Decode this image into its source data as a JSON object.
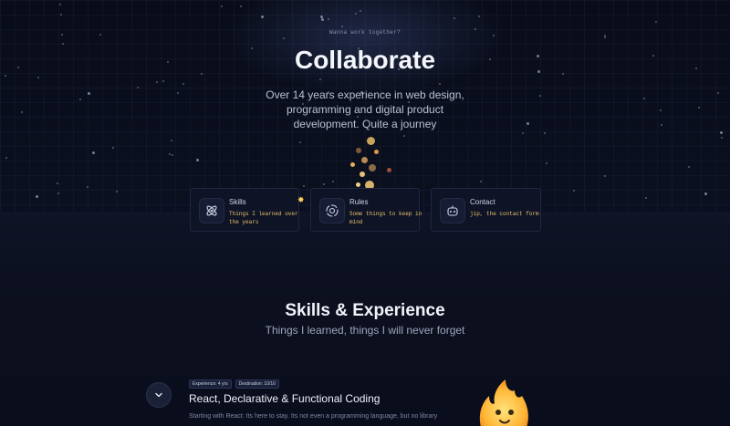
{
  "hero": {
    "eyebrow": "Wanna work together?",
    "title": "Collaborate",
    "subtitle": "Over 14 years experience in web design, programming and digital product development. Quite a journey"
  },
  "cards": [
    {
      "name": "Skills",
      "description": "Things I learned over the years",
      "icon": "atom-icon"
    },
    {
      "name": "Rules",
      "description": "Some things to keep in mind",
      "icon": "target-icon"
    },
    {
      "name": "Contact",
      "description": "jip, the contact form",
      "icon": "robot-icon"
    }
  ],
  "skills_section": {
    "title": "Skills & Experience",
    "subtitle": "Things I learned, things I will never forget"
  },
  "experience_item": {
    "badges": [
      "Experience: 4 yrs",
      "Destination: 10/10"
    ],
    "title": "React, Declarative & Functional Coding",
    "text": "Starting with React: Its here to stay. Its not even a programming language, but no library",
    "expand_icon": "chevron-down-icon"
  },
  "colors": {
    "background": "#0a0e1c",
    "accent_yellow": "#e8c46a",
    "card_border": "#1f2740"
  }
}
